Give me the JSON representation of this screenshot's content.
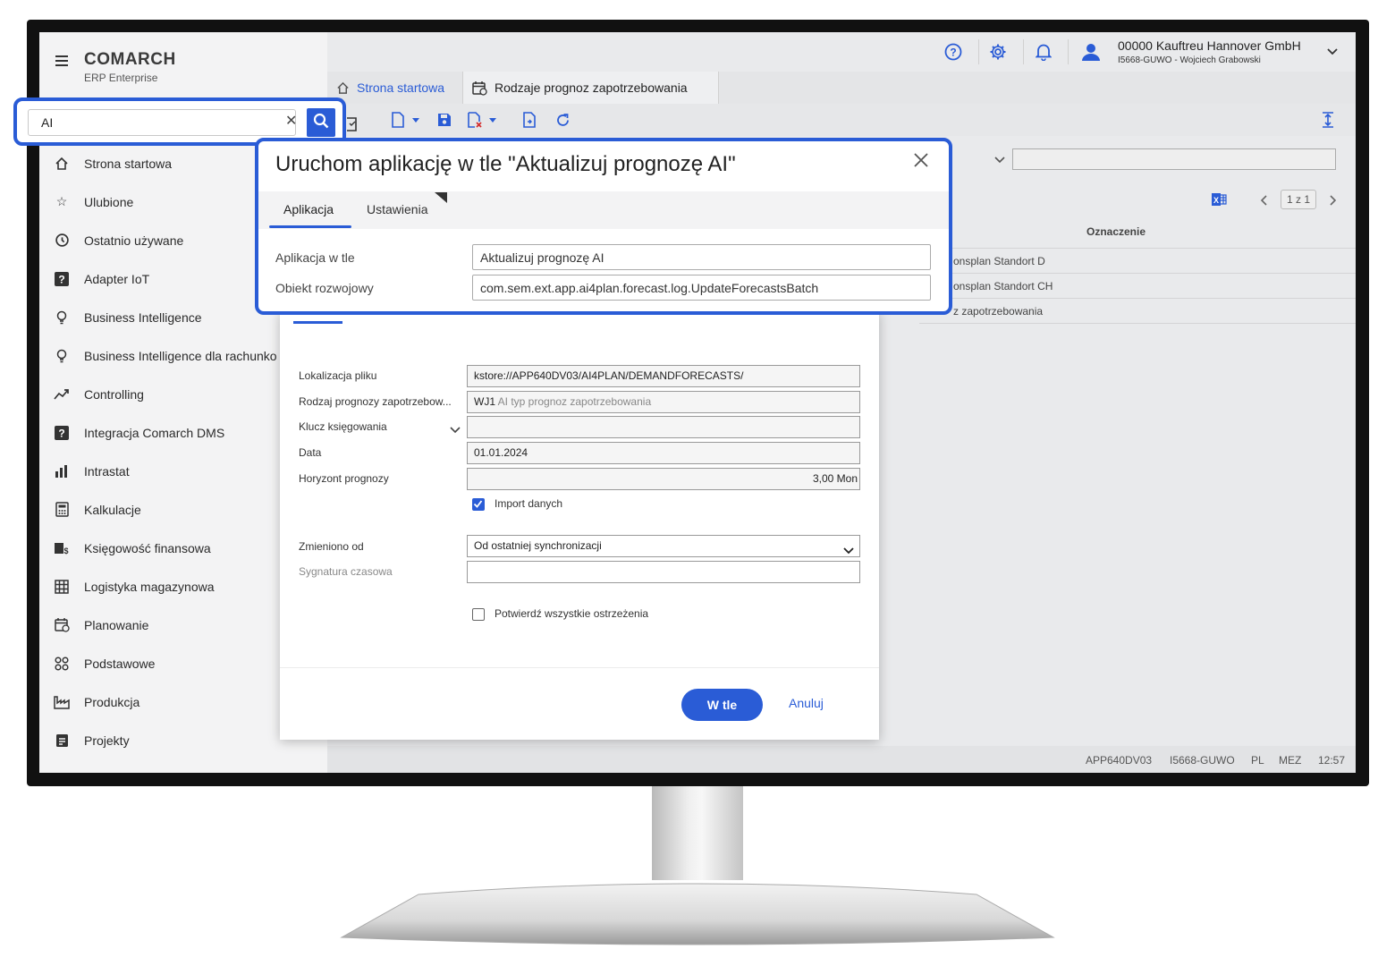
{
  "app": {
    "brand": "COMARCH",
    "product": "ERP Enterprise"
  },
  "search": {
    "value": "AI"
  },
  "sidebar": {
    "items": [
      {
        "label": "Strona startowa",
        "icon": "home-icon"
      },
      {
        "label": "Ulubione",
        "icon": "star-icon"
      },
      {
        "label": "Ostatnio używane",
        "icon": "history-icon"
      },
      {
        "label": "Adapter IoT",
        "icon": "help-square-icon"
      },
      {
        "label": "Business Intelligence",
        "icon": "bulb-icon"
      },
      {
        "label": "Business Intelligence dla rachunko",
        "icon": "bulb-icon"
      },
      {
        "label": "Controlling",
        "icon": "trend-icon"
      },
      {
        "label": "Integracja Comarch DMS",
        "icon": "help-square-icon"
      },
      {
        "label": "Intrastat",
        "icon": "chart-icon"
      },
      {
        "label": "Kalkulacje",
        "icon": "calculator-icon"
      },
      {
        "label": "Księgowość finansowa",
        "icon": "finance-icon"
      },
      {
        "label": "Logistyka magazynowa",
        "icon": "grid-icon"
      },
      {
        "label": "Planowanie",
        "icon": "calendar-icon"
      },
      {
        "label": "Podstawowe",
        "icon": "apps-icon"
      },
      {
        "label": "Produkcja",
        "icon": "factory-icon"
      },
      {
        "label": "Projekty",
        "icon": "project-icon"
      }
    ]
  },
  "header": {
    "company": "00000  Kauftreu Hannover GmbH",
    "user": "I5668-GUWO - Wojciech Grabowski"
  },
  "tabs": {
    "home": "Strona startowa",
    "active": "Rodzaje prognoz zapotrzebowania"
  },
  "list": {
    "pager": "1 z 1",
    "column": "Oznaczenie",
    "rows": [
      "onsplan Standort D",
      "onsplan Standort CH",
      "z zapotrzebowania"
    ]
  },
  "status_bar": {
    "system": "APP640DV03",
    "user": "I5668-GUWO",
    "lang": "PL",
    "tz": "MEZ",
    "time": "12:57"
  },
  "dialog_main": {
    "title": "Uruchom aplikację w tle \"Aktualizuj prognozę AI\"",
    "tabs": [
      "Aplikacja",
      "Ustawienia"
    ],
    "fields": [
      {
        "label": "Aplikacja w tle",
        "value": "Aktualizuj prognozę AI"
      },
      {
        "label": "Obiekt rozwojowy",
        "value": "com.sem.ext.app.ai4plan.forecast.log.UpdateForecastsBatch"
      }
    ]
  },
  "dialog_params": {
    "fields": {
      "file_location": {
        "label": "Lokalizacja pliku",
        "value": "kstore://APP640DV03/AI4PLAN/DEMANDFORECASTS/"
      },
      "forecast_type": {
        "label": "Rodzaj prognozy zapotrzebow...",
        "code": "WJ1",
        "value": "AI typ prognoz zapotrzebowania"
      },
      "posting_key": {
        "label": "Klucz księgowania",
        "value": ""
      },
      "date": {
        "label": "Data",
        "value": "01.01.2024"
      },
      "horizon": {
        "label": "Horyzont prognozy",
        "value": "3,00  Mon"
      },
      "changed_from": {
        "label": "Zmieniono od",
        "value": "Od ostatniej synchronizacji"
      },
      "timestamp": {
        "label": "Sygnatura czasowa",
        "value": ""
      }
    },
    "import_data": {
      "label": "Import danych",
      "checked": true
    },
    "confirm_warnings": {
      "label": "Potwierdź wszystkie ostrzeżenia",
      "checked": false
    },
    "submit": "W tle",
    "cancel": "Anuluj"
  },
  "colors": {
    "accent": "#2a5cd6",
    "bezel": "#111111"
  }
}
